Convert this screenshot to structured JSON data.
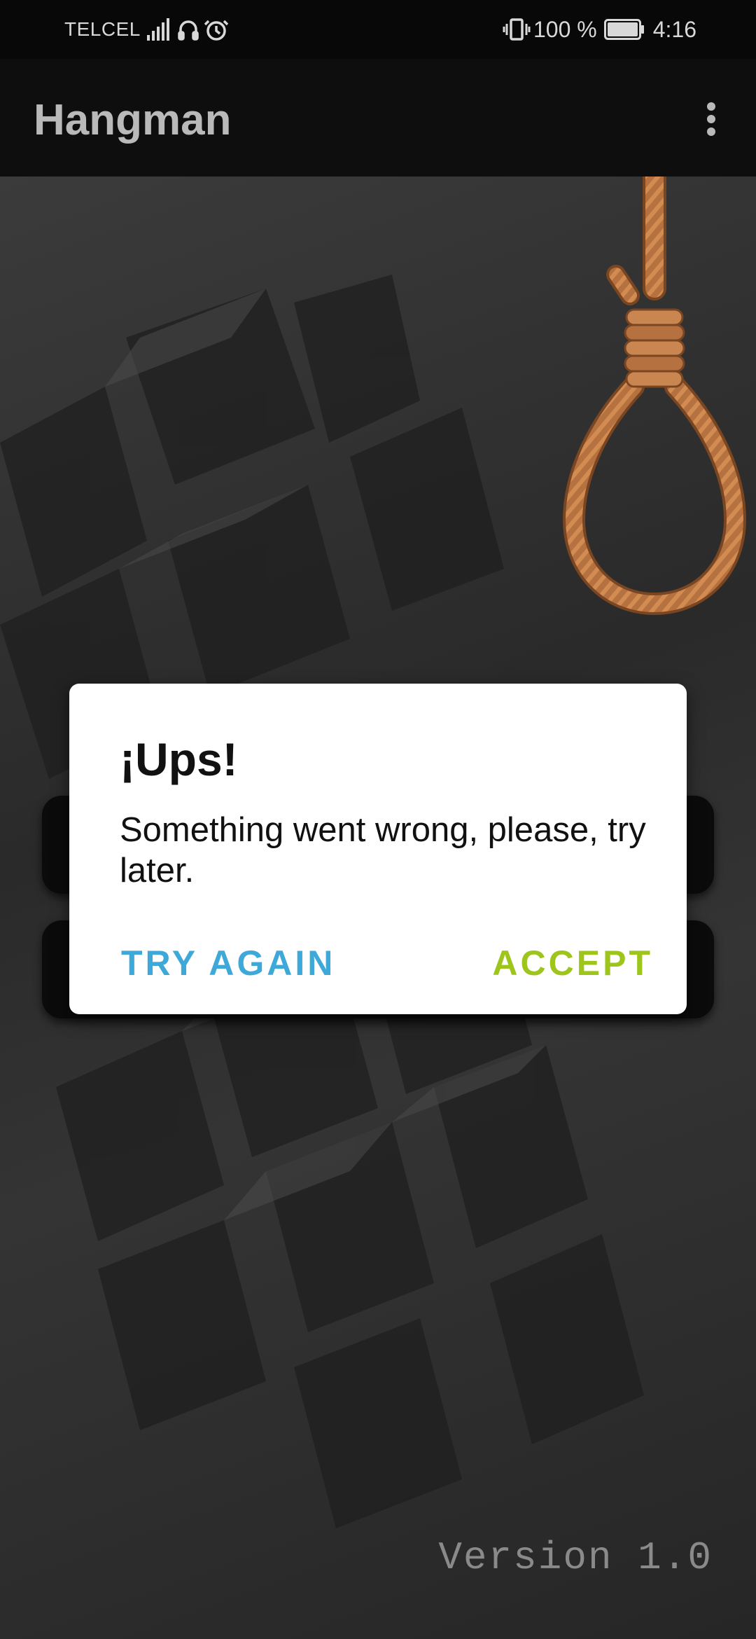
{
  "status_bar": {
    "carrier": "TELCEL",
    "battery": "100 %",
    "time": "4:16",
    "left_icons": [
      "signal-icon",
      "headset-icon",
      "alarm-icon"
    ],
    "right_icons": [
      "vibrate-icon",
      "battery-icon"
    ]
  },
  "app_bar": {
    "title": "Hangman",
    "menu_icon": "more-vert-icon"
  },
  "dialog": {
    "title": "¡Ups!",
    "message": "Something went wrong, please, try later.",
    "try_again_label": "TRY AGAIN",
    "accept_label": "ACCEPT"
  },
  "footer": {
    "version": "Version 1.0"
  },
  "colors": {
    "try_again": "#3ea9d8",
    "accept": "#9ec51b",
    "app_bar": "#0e0e0e",
    "status_bar": "#080808"
  }
}
